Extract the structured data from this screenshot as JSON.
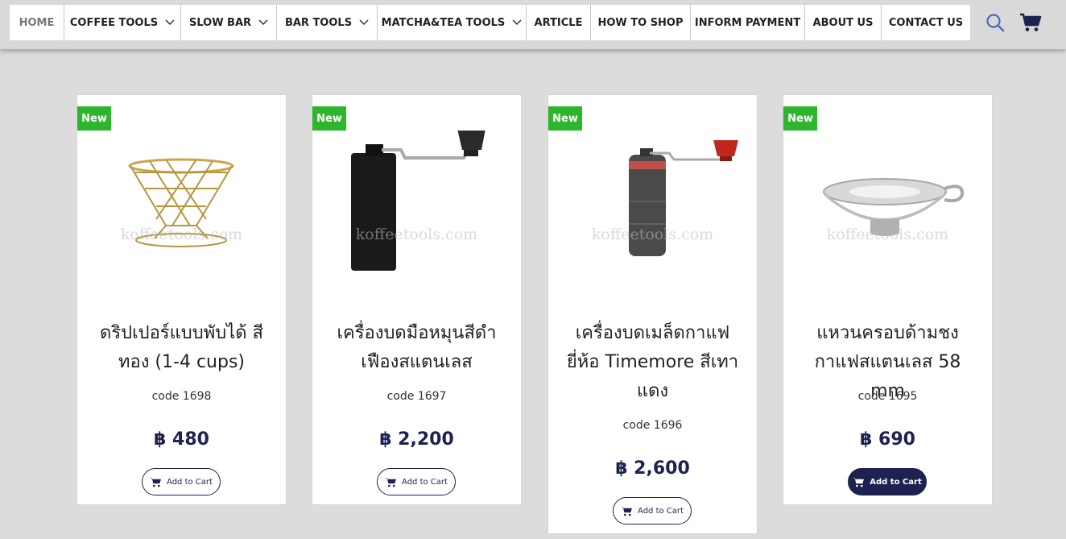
{
  "nav": {
    "items": [
      {
        "label": "HOME",
        "dropdown": false
      },
      {
        "label": "COFFEE TOOLS",
        "dropdown": true
      },
      {
        "label": "SLOW BAR",
        "dropdown": true
      },
      {
        "label": "BAR TOOLS",
        "dropdown": true
      },
      {
        "label": "MATCHA&TEA TOOLS",
        "dropdown": true
      },
      {
        "label": "ARTICLE",
        "dropdown": false
      },
      {
        "label": "HOW TO SHOP",
        "dropdown": false
      },
      {
        "label": "INFORM PAYMENT",
        "dropdown": false
      },
      {
        "label": "ABOUT US",
        "dropdown": false
      },
      {
        "label": "CONTACT US",
        "dropdown": false
      }
    ],
    "icons": [
      "search-icon",
      "cart-icon"
    ]
  },
  "colors": {
    "accent": "#1d2250",
    "badge": "#2db52d",
    "background": "#dcdcdc"
  },
  "products": [
    {
      "badge": "New",
      "watermark": "koffeetools.com",
      "title": "ดริปเปอร์แบบพับได้ สีทอง (1-4 cups)",
      "code": "code 1698",
      "price": "฿ 480",
      "button": "Add to Cart"
    },
    {
      "badge": "New",
      "watermark": "koffeetools.com",
      "title": "เครื่องบดมือหมุนสีดำเฟืองสแตนเลส",
      "code": "code 1697",
      "price": "฿ 2,200",
      "button": "Add to Cart"
    },
    {
      "badge": "New",
      "watermark": "koffeetools.com",
      "title": "เครื่องบดเมล็ดกาแฟยี่ห้อ Timemore สีเทาแดง",
      "code": "code 1696",
      "price": "฿ 2,600",
      "button": "Add to Cart"
    },
    {
      "badge": "New",
      "watermark": "koffeetools.com",
      "title": "แหวนครอบด้ามชงกาแฟสแตนเลส 58 mm",
      "code": "code 1695",
      "price": "฿ 690",
      "button": "Add to Cart"
    }
  ]
}
